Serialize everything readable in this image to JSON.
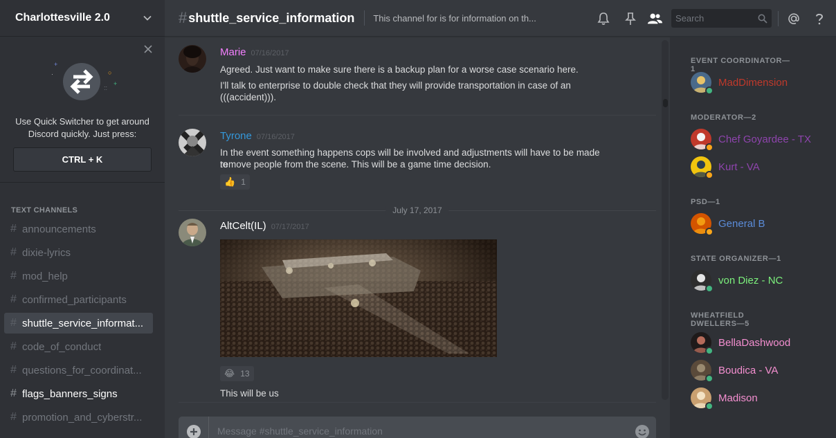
{
  "server": {
    "name": "Charlottesville 2.0"
  },
  "quick_switcher": {
    "text": "Use Quick Switcher to get around Discord quickly. Just press:",
    "shortcut": "CTRL + K"
  },
  "channels": {
    "header": "TEXT CHANNELS",
    "items": [
      {
        "name": "announcements",
        "state": "normal"
      },
      {
        "name": "dixie-lyrics",
        "state": "normal"
      },
      {
        "name": "mod_help",
        "state": "normal"
      },
      {
        "name": "confirmed_participants",
        "state": "normal"
      },
      {
        "name": "shuttle_service_informat...",
        "state": "active"
      },
      {
        "name": "code_of_conduct",
        "state": "normal"
      },
      {
        "name": "questions_for_coordinat...",
        "state": "normal"
      },
      {
        "name": "flags_banners_signs",
        "state": "unread"
      },
      {
        "name": "promotion_and_cyberstr...",
        "state": "normal"
      }
    ]
  },
  "header": {
    "channel": "shuttle_service_information",
    "topic": "This channel for is for information on th...",
    "search_placeholder": "Search",
    "icons": [
      "bell-icon",
      "pin-icon",
      "members-icon",
      "search-icon",
      "mention-icon",
      "help-icon"
    ]
  },
  "messages": [
    {
      "author": "Marie",
      "color": "#f47fff",
      "time": "07/16/2017",
      "lines": [
        "Agreed. Just want to make sure there is a backup plan for a worse case scenario here.",
        "I'll talk to enterprise to double check that they will provide transportation in case of an",
        "(((accident)))."
      ]
    },
    {
      "author": "Tyrone",
      "color": "#3498db",
      "time": "07/16/2017",
      "lines": [
        "In the event something happens cops will be involved and adjustments will have to be made to",
        "remove people from the scene. This will be a game time decision."
      ],
      "reaction": {
        "emoji": "👍",
        "count": "1"
      }
    },
    {
      "author": "AltCelt(IL)",
      "color": "#ffffff",
      "time": "07/17/2017",
      "image": "crowd-photo",
      "reaction": {
        "emoji": "😂",
        "count": "13"
      },
      "lines": [
        "This will be us"
      ]
    }
  ],
  "date_divider": "July 17, 2017",
  "composer": {
    "placeholder": "Message #shuttle_service_information"
  },
  "members": {
    "roles": [
      {
        "name": "EVENT COORDINATOR—1",
        "people": [
          {
            "name": "MadDimension",
            "color": "#c0392b",
            "status": "online"
          }
        ]
      },
      {
        "name": "MODERATOR—2",
        "people": [
          {
            "name": "Chef Goyardee - TX",
            "color": "#8e44ad",
            "status": "idle"
          },
          {
            "name": "Kurt - VA",
            "color": "#8e44ad",
            "status": "idle"
          }
        ]
      },
      {
        "name": "PSD—1",
        "people": [
          {
            "name": "General B",
            "color": "#5b8cd9",
            "status": "idle"
          }
        ]
      },
      {
        "name": "STATE ORGANIZER—1",
        "people": [
          {
            "name": "von Diez - NC",
            "color": "#7cf07c",
            "status": "online"
          }
        ]
      },
      {
        "name": "WHEATFIELD DWELLERS—5",
        "people": [
          {
            "name": "BellaDashwood",
            "color": "#f48fd0",
            "status": "online"
          },
          {
            "name": "Boudica - VA",
            "color": "#f48fd0",
            "status": "online"
          },
          {
            "name": "Madison",
            "color": "#f48fd0",
            "status": "online"
          }
        ]
      }
    ]
  },
  "colors": {
    "online": "#43b581",
    "idle": "#faa61a",
    "accent": "#7289da"
  }
}
